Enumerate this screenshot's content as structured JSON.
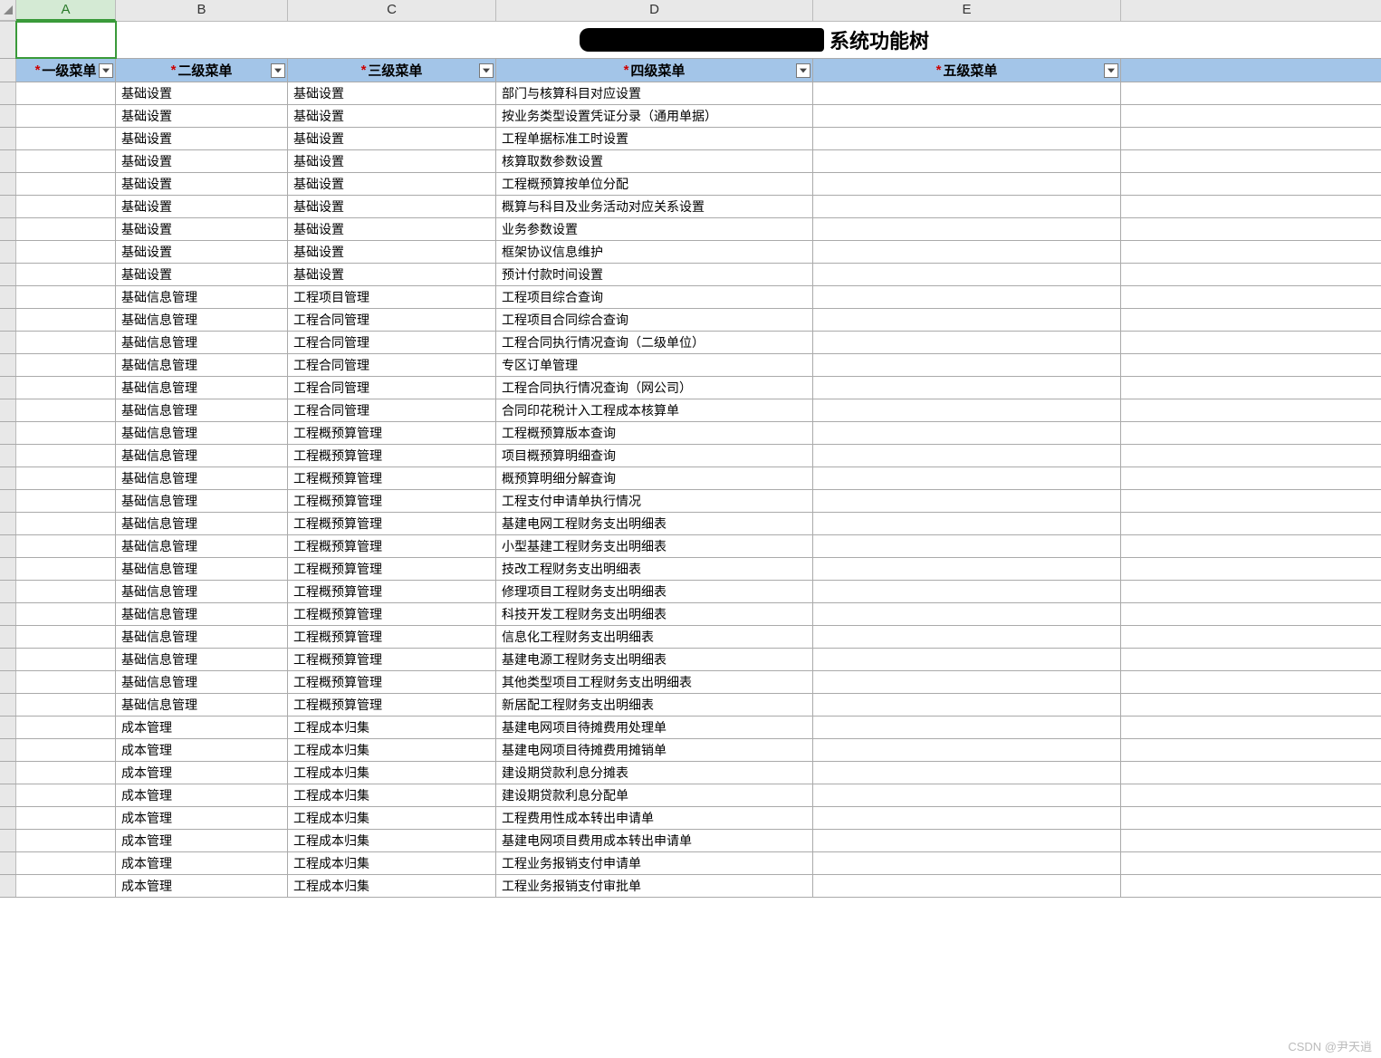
{
  "columns": [
    {
      "letter": "A",
      "width_class": "cA",
      "selected": true
    },
    {
      "letter": "B",
      "width_class": "cB",
      "selected": false
    },
    {
      "letter": "C",
      "width_class": "cC",
      "selected": false
    },
    {
      "letter": "D",
      "width_class": "cD",
      "selected": false
    },
    {
      "letter": "E",
      "width_class": "cE",
      "selected": false
    }
  ],
  "title": "系统功能树",
  "headers": {
    "a": "一级菜单",
    "b": "二级菜单",
    "c": "三级菜单",
    "d": "四级菜单",
    "e": "五级菜单",
    "required_marker": "*"
  },
  "rows": [
    {
      "b": "基础设置",
      "c": "基础设置",
      "d": "部门与核算科目对应设置",
      "e": ""
    },
    {
      "b": "基础设置",
      "c": "基础设置",
      "d": "按业务类型设置凭证分录（通用单据）",
      "e": ""
    },
    {
      "b": "基础设置",
      "c": "基础设置",
      "d": "工程单据标准工时设置",
      "e": ""
    },
    {
      "b": "基础设置",
      "c": "基础设置",
      "d": "核算取数参数设置",
      "e": ""
    },
    {
      "b": "基础设置",
      "c": "基础设置",
      "d": "工程概预算按单位分配",
      "e": ""
    },
    {
      "b": "基础设置",
      "c": "基础设置",
      "d": "概算与科目及业务活动对应关系设置",
      "e": ""
    },
    {
      "b": "基础设置",
      "c": "基础设置",
      "d": "业务参数设置",
      "e": ""
    },
    {
      "b": "基础设置",
      "c": "基础设置",
      "d": "框架协议信息维护",
      "e": ""
    },
    {
      "b": "基础设置",
      "c": "基础设置",
      "d": "预计付款时间设置",
      "e": ""
    },
    {
      "b": "基础信息管理",
      "c": "工程项目管理",
      "d": "工程项目综合查询",
      "e": ""
    },
    {
      "b": "基础信息管理",
      "c": "工程合同管理",
      "d": "工程项目合同综合查询",
      "e": ""
    },
    {
      "b": "基础信息管理",
      "c": "工程合同管理",
      "d": "工程合同执行情况查询（二级单位）",
      "e": ""
    },
    {
      "b": "基础信息管理",
      "c": "工程合同管理",
      "d": "专区订单管理",
      "e": ""
    },
    {
      "b": "基础信息管理",
      "c": "工程合同管理",
      "d": "工程合同执行情况查询（网公司）",
      "e": ""
    },
    {
      "b": "基础信息管理",
      "c": "工程合同管理",
      "d": "合同印花税计入工程成本核算单",
      "e": ""
    },
    {
      "b": "基础信息管理",
      "c": "工程概预算管理",
      "d": "工程概预算版本查询",
      "e": ""
    },
    {
      "b": "基础信息管理",
      "c": "工程概预算管理",
      "d": "项目概预算明细查询",
      "e": ""
    },
    {
      "b": "基础信息管理",
      "c": "工程概预算管理",
      "d": "概预算明细分解查询",
      "e": ""
    },
    {
      "b": "基础信息管理",
      "c": "工程概预算管理",
      "d": "工程支付申请单执行情况",
      "e": ""
    },
    {
      "b": "基础信息管理",
      "c": "工程概预算管理",
      "d": "基建电网工程财务支出明细表",
      "e": ""
    },
    {
      "b": "基础信息管理",
      "c": "工程概预算管理",
      "d": "小型基建工程财务支出明细表",
      "e": ""
    },
    {
      "b": "基础信息管理",
      "c": "工程概预算管理",
      "d": "技改工程财务支出明细表",
      "e": ""
    },
    {
      "b": "基础信息管理",
      "c": "工程概预算管理",
      "d": "修理项目工程财务支出明细表",
      "e": ""
    },
    {
      "b": "基础信息管理",
      "c": "工程概预算管理",
      "d": "科技开发工程财务支出明细表",
      "e": ""
    },
    {
      "b": "基础信息管理",
      "c": "工程概预算管理",
      "d": "信息化工程财务支出明细表",
      "e": ""
    },
    {
      "b": "基础信息管理",
      "c": "工程概预算管理",
      "d": "基建电源工程财务支出明细表",
      "e": ""
    },
    {
      "b": "基础信息管理",
      "c": "工程概预算管理",
      "d": "其他类型项目工程财务支出明细表",
      "e": ""
    },
    {
      "b": "基础信息管理",
      "c": "工程概预算管理",
      "d": "新居配工程财务支出明细表",
      "e": ""
    },
    {
      "b": "成本管理",
      "c": "工程成本归集",
      "d": "基建电网项目待摊费用处理单",
      "e": ""
    },
    {
      "b": "成本管理",
      "c": "工程成本归集",
      "d": "基建电网项目待摊费用摊销单",
      "e": ""
    },
    {
      "b": "成本管理",
      "c": "工程成本归集",
      "d": "建设期贷款利息分摊表",
      "e": ""
    },
    {
      "b": "成本管理",
      "c": "工程成本归集",
      "d": "建设期贷款利息分配单",
      "e": ""
    },
    {
      "b": "成本管理",
      "c": "工程成本归集",
      "d": "工程费用性成本转出申请单",
      "e": ""
    },
    {
      "b": "成本管理",
      "c": "工程成本归集",
      "d": "基建电网项目费用成本转出申请单",
      "e": ""
    },
    {
      "b": "成本管理",
      "c": "工程成本归集",
      "d": "工程业务报销支付申请单",
      "e": ""
    },
    {
      "b": "成本管理",
      "c": "工程成本归集",
      "d": "工程业务报销支付审批单",
      "e": ""
    }
  ],
  "watermark": "CSDN @尹天逍"
}
